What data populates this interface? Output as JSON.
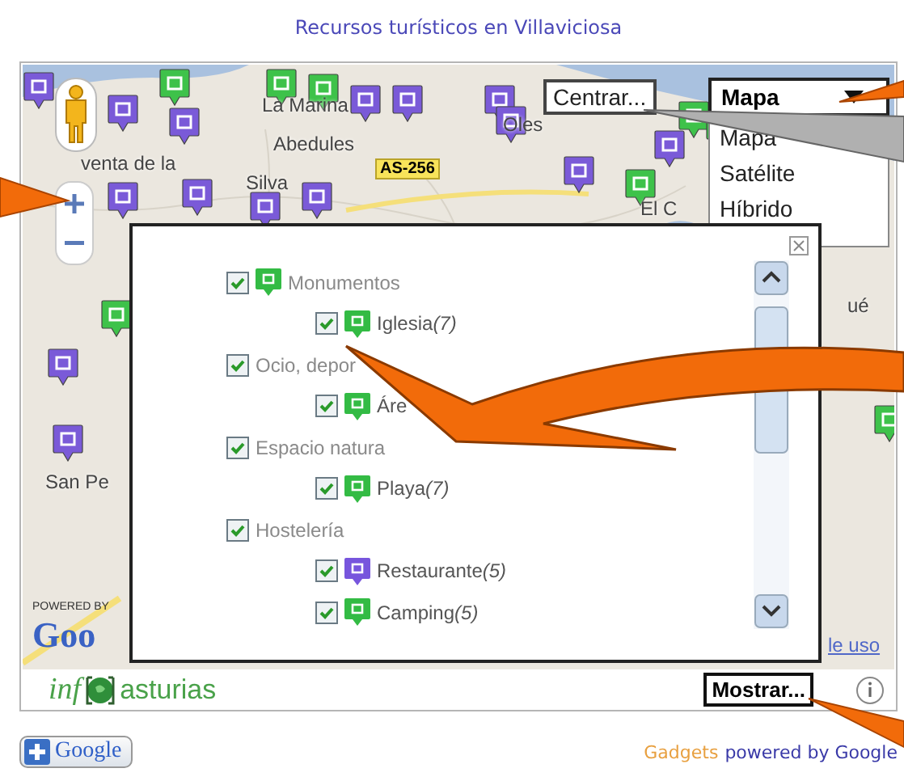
{
  "title": "Recursos turísticos en Villaviciosa",
  "map": {
    "labels": [
      "La Marina",
      "Abedules",
      "Silva",
      "Oles",
      "El C",
      "venta de la",
      "San Pe",
      "ué"
    ],
    "road_sign": "AS-256",
    "powered_by": "POWERED BY",
    "logo": "Goo",
    "terms_link": "le uso"
  },
  "centrar_button": "Centrar...",
  "map_type": {
    "value": "Mapa",
    "options": [
      "Mapa",
      "Satélite",
      "Híbrido"
    ]
  },
  "layers_panel": {
    "groups": [
      {
        "label": "Monumentos",
        "checked": true,
        "color": "#33bb44",
        "items": [
          {
            "label": "Iglesia",
            "count": "(7)",
            "checked": true,
            "color": "#33bb44"
          }
        ]
      },
      {
        "label": "Ocio, depor",
        "checked": true,
        "items": [
          {
            "label": "Áre",
            "checked": true,
            "color": "#33bb44"
          }
        ]
      },
      {
        "label": "Espacio natura",
        "checked": true,
        "items": [
          {
            "label": "Playa",
            "count": "(7)",
            "checked": true,
            "color": "#33bb44"
          }
        ]
      },
      {
        "label": "Hostelería",
        "checked": true,
        "items": [
          {
            "label": "Restaurante",
            "count": "(5)",
            "checked": true,
            "color": "#7755dd"
          },
          {
            "label": "Camping",
            "count": "(5)",
            "checked": true,
            "color": "#33bb44"
          }
        ]
      }
    ]
  },
  "bottom_bar": {
    "logo_left": "inf",
    "logo_right": "asturias",
    "mostrar_button": "Mostrar..."
  },
  "footer": {
    "add_button": "Google",
    "gadgets": "Gadgets",
    "powered_by": "powered by Google"
  }
}
